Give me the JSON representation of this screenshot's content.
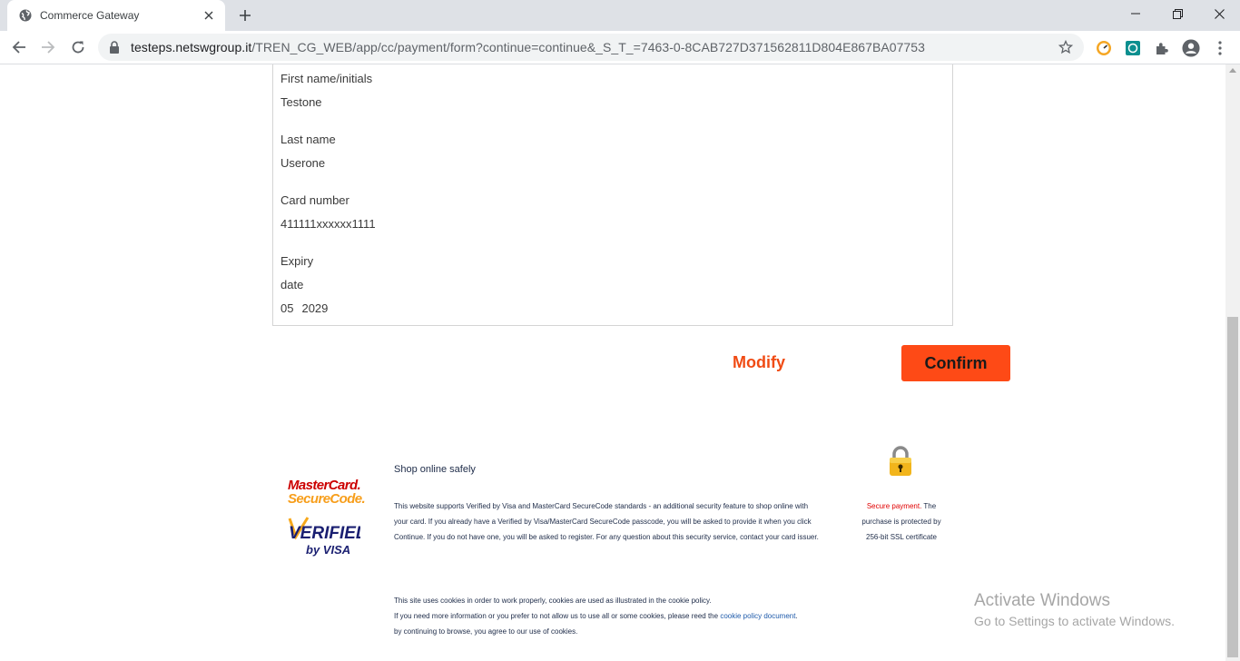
{
  "browser": {
    "tab_title": "Commerce Gateway",
    "url_host": "testeps.netswgroup.it",
    "url_path": "/TREN_CG_WEB/app/cc/payment/form?continue=continue&_S_T_=7463-0-8CAB727D371562811D804E867BA07753"
  },
  "form": {
    "first_name_label": "First name/initials",
    "first_name_value": "Testone",
    "last_name_label": "Last name",
    "last_name_value": "Userone",
    "card_number_label": "Card number",
    "card_number_value": "411111xxxxxx1111",
    "expiry_label_1": "Expiry",
    "expiry_label_2": "date",
    "expiry_month": "05",
    "expiry_year": "2029"
  },
  "actions": {
    "modify_label": "Modify",
    "confirm_label": "Confirm"
  },
  "footer": {
    "mastercard_line1": "MasterCard.",
    "mastercard_line2": "SecureCode.",
    "visa_line1": "VERIFIED",
    "visa_line2": "by VISA",
    "safe_title": "Shop online safely",
    "safe_text": "This website supports Verified by Visa and MasterCard SecureCode standards - an additional security feature to shop online with your card. If you already have a Verified by Visa/MasterCard SecureCode passcode, you will be asked to provide it when you click Continue. If you do not have one, you will be asked to register. For any question about this security service, contact your card issuer.",
    "secure_red": "Secure payment.",
    "secure_rest": " The purchase is protected by 256-bit SSL certificate",
    "cookie_line1": "This site uses cookies in order to work properly, cookies are used as illustrated in the cookie policy.",
    "cookie_line2_pre": "If you need more information or you prefer to not allow us to use all or some cookies, please reed the ",
    "cookie_link": "cookie policy document",
    "cookie_line2_post": ".",
    "cookie_line3": "by continuing to browse, you agree to our use of cookies."
  },
  "watermark": {
    "line1": "Activate Windows",
    "line2": "Go to Settings to activate Windows."
  },
  "colors": {
    "accent": "#fe4a16",
    "modify": "#f04b14",
    "link": "#1f5bab",
    "secure_red": "#e00000"
  }
}
